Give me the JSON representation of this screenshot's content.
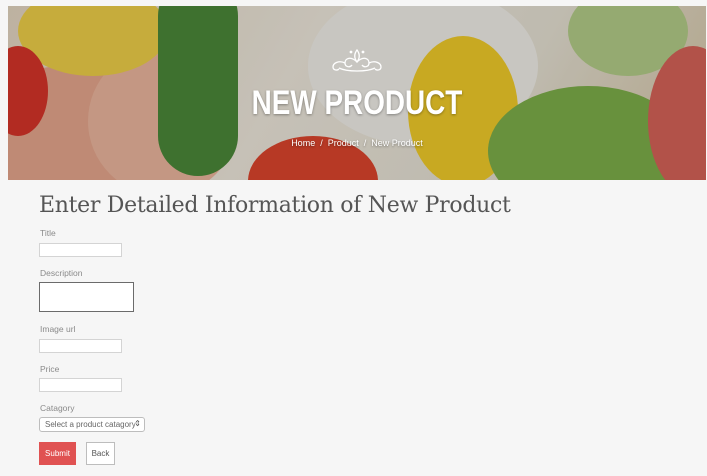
{
  "hero": {
    "title": "NEW PRODUCT",
    "ornament_icon": "floral-ornament-icon",
    "breadcrumb": [
      "Home",
      "Product",
      "New Product"
    ],
    "breadcrumb_separator": "/"
  },
  "form": {
    "heading": "Enter Detailed Information of New Product",
    "title_label": "Title",
    "title_value": "",
    "description_label": "Description",
    "description_value": "",
    "image_label": "Image url",
    "image_value": "",
    "price_label": "Price",
    "price_value": "",
    "category_label": "Catagory",
    "category_selected": "Select a product catagory",
    "submit_label": "Submit",
    "back_label": "Back"
  },
  "colors": {
    "submit_bg": "#e05252",
    "page_bg": "#f6f6f6"
  }
}
